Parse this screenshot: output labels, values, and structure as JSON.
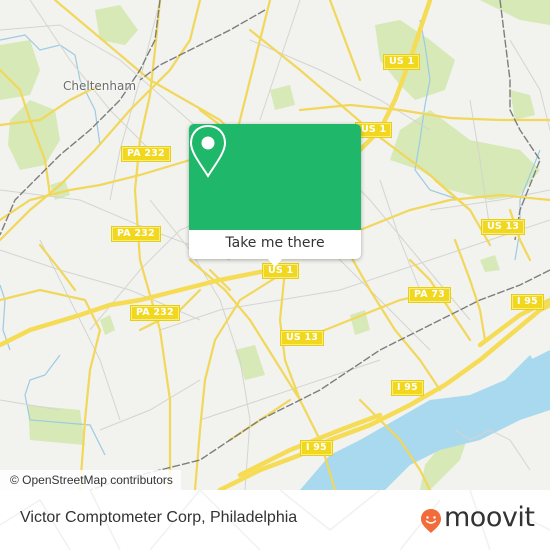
{
  "map": {
    "place_labels": [
      {
        "id": "cheltenham",
        "text": "Cheltenham"
      }
    ],
    "road_shields": [
      {
        "id": "us1-top",
        "text": "US 1"
      },
      {
        "id": "us1-mid",
        "text": "US 1"
      },
      {
        "id": "us1-pin",
        "text": "US 1"
      },
      {
        "id": "pa232-a",
        "text": "PA 232"
      },
      {
        "id": "pa232-b",
        "text": "PA 232"
      },
      {
        "id": "pa232-c",
        "text": "PA 232"
      },
      {
        "id": "us13-east",
        "text": "US 13"
      },
      {
        "id": "us13-center",
        "text": "US 13"
      },
      {
        "id": "pa73",
        "text": "PA 73"
      },
      {
        "id": "i95-east",
        "text": "I 95"
      },
      {
        "id": "i95-mid",
        "text": "I 95"
      },
      {
        "id": "i95-south",
        "text": "I 95"
      }
    ],
    "attribution": "© OpenStreetMap contributors",
    "colors": {
      "land": "#f2f2ee",
      "road": "#f5dc54",
      "minor_road": "#cfcfcf",
      "water": "#a9d9ee",
      "park": "#d6e9b7",
      "rail": "#7a7a7a"
    }
  },
  "popup": {
    "icon": "map-pin-icon",
    "button_label": "Take me there",
    "color": "#1fb76a"
  },
  "footer": {
    "title": "Victor Comptometer Corp, Philadelphia",
    "logo_text": "moovit",
    "logo_color": "#f26b3a"
  }
}
